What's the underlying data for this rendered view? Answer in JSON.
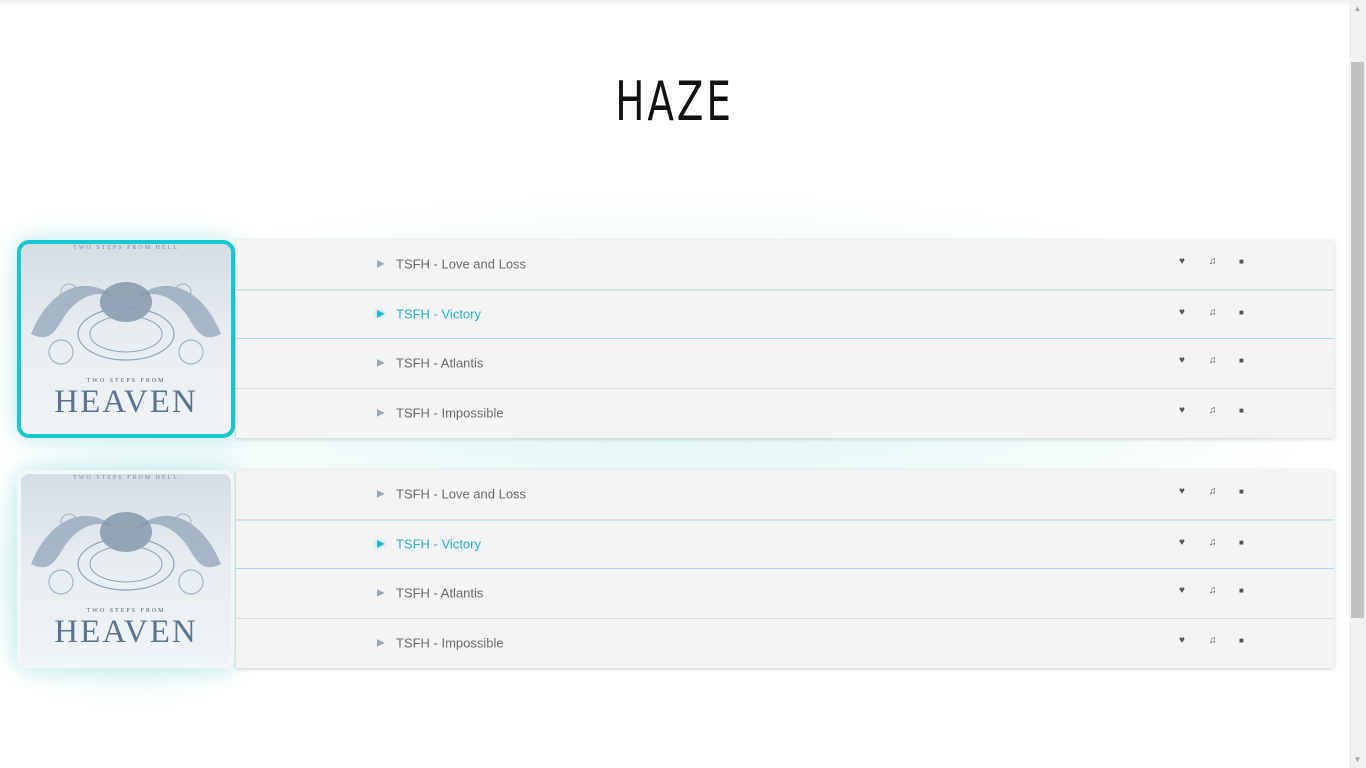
{
  "page": {
    "title": "HAZE"
  },
  "albums": [
    {
      "cover": {
        "top_text": "TWO STEPS FROM HELL",
        "sub_text": "TWO STEPS FROM",
        "main_text": "HEAVEN"
      },
      "tracks": [
        {
          "label": "TSFH - Love and Loss",
          "active": false
        },
        {
          "label": "TSFH - Victory",
          "active": true
        },
        {
          "label": "TSFH - Atlantis",
          "active": false
        },
        {
          "label": "TSFH - Impossible",
          "active": false
        }
      ]
    },
    {
      "cover": {
        "top_text": "TWO STEPS FROM HELL",
        "sub_text": "TWO STEPS FROM",
        "main_text": "HEAVEN"
      },
      "tracks": [
        {
          "label": "TSFH - Love and Loss",
          "active": false
        },
        {
          "label": "TSFH - Victory",
          "active": true
        },
        {
          "label": "TSFH - Atlantis",
          "active": false
        },
        {
          "label": "TSFH - Impossible",
          "active": false
        }
      ]
    }
  ],
  "icons": {
    "play": "play-icon",
    "like": "heart-icon",
    "lyrics": "music-note-icon",
    "stop": "stop-icon"
  },
  "glyphs": {
    "play": "▶",
    "heart": "♥",
    "note": "♫",
    "stop": "■",
    "scroll_up": "▲",
    "scroll_down": "▼"
  },
  "colors": {
    "accent": "#18c8cc",
    "active_text": "#2aaed8",
    "row_bg": "#f4f4f4",
    "title": "#111111"
  }
}
